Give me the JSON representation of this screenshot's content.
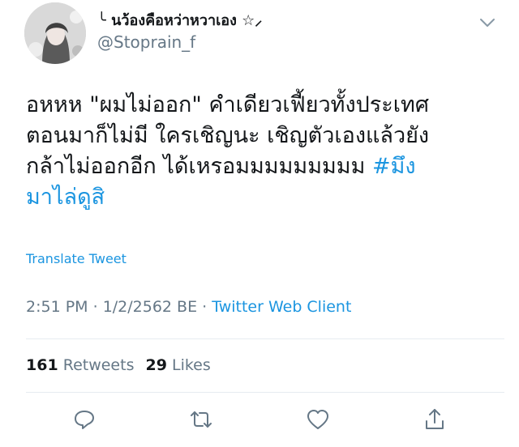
{
  "user": {
    "display_name": "╰ นว้องคือหว่าหวาเอง ☆⸝",
    "handle": "@Stoprain_f",
    "avatar_icon": "avatar-illustration"
  },
  "tweet": {
    "lines": [
      "อหหห \"ผมไม่ออก\" คำเดียวเฟี้ยวทั้งประเทศ",
      "ตอนมาก็ไม่มี ใครเชิญนะ เชิญตัวเองแล้วยัง",
      "กล้าไม่ออกอีก ได้เหรอมมมมมมมมม "
    ],
    "hashtag_part1": "#มึง",
    "hashtag_part2": "มาไล่ดูสิ",
    "translate_label": "Translate Tweet"
  },
  "meta": {
    "time": "2:51 PM",
    "separator": " · ",
    "date": "1/2/2562 BE",
    "client": "Twitter Web Client"
  },
  "stats": {
    "retweets_count": "161",
    "retweets_label": "Retweets",
    "likes_count": "29",
    "likes_label": "Likes"
  },
  "actions": {
    "reply_icon": "reply-icon",
    "retweet_icon": "retweet-icon",
    "like_icon": "heart-icon",
    "share_icon": "share-icon"
  },
  "colors": {
    "link": "#1b95e0",
    "secondary_text": "#657786",
    "primary_text": "#14171a",
    "divider": "#e6ecf0"
  }
}
